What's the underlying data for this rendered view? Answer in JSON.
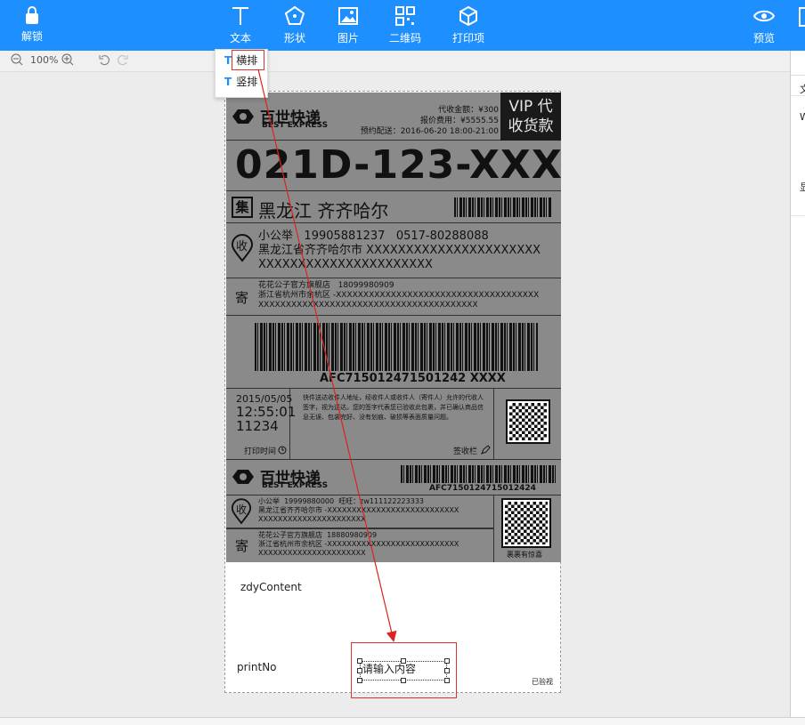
{
  "toolbar": {
    "unlock": "解锁",
    "text": "文本",
    "shape": "形状",
    "image": "图片",
    "qrcode": "二维码",
    "print_item": "打印项",
    "preview": "预览"
  },
  "zoom": {
    "level": "100%"
  },
  "dropdown": {
    "horizontal": "横排",
    "vertical": "竖排"
  },
  "right_panel": {
    "l1": "文",
    "l2": "W",
    "l3": "显"
  },
  "label": {
    "brand_cn": "百世快递",
    "brand_en": "BEST EXPRESS",
    "cod_amount": "代收金额：¥300",
    "insured_fee": "报价费用：¥5555.55",
    "scheduled": "预约配送：2016-06-20 18:00-21:00",
    "vip_line1": "VIP 代",
    "vip_line2": "收货款",
    "big_code": "021D-123-XXX",
    "collect_tag": "集",
    "destination": "黑龙江 齐齐哈尔",
    "recv_tag": "收",
    "recv_name": "小公举",
    "recv_phone1": "19905881237",
    "recv_phone2": "0517-80288088",
    "recv_addr1": "黑龙江省齐齐哈尔市 XXXXXXXXXXXXXXXXXXXXXX",
    "recv_addr2": "XXXXXXXXXXXXXXXXXXXXXX",
    "send_tag": "寄",
    "send_name": "花花公子官方旗舰店",
    "send_phone": "18099980909",
    "send_addr1": "浙江省杭州市余杭区 -XXXXXXXXXXXXXXXXXXXXXXXXXXXXXXXXXXXXX",
    "send_addr2": "XXXXXXXXXXXXXXXXXXXXXXXXXXXXXXXXXXXXXXXX",
    "tracking": "AFC715012471501242 XXXX",
    "date": "2015/05/05",
    "time": "12:55:01",
    "num": "11234",
    "print_time": "打印时间",
    "notice": "快件送达收件人地址，经收件人或收件人（寄件人）允许的代收人签字，视为送达。您的签字代表您已验收此包裹，并已确认商品信息无误、包装完好、没有划痕、破损等表面质量问题。",
    "sign_here": "签收栏",
    "tracking2": "AFC7150124715012424",
    "s2_recv_name": "小公举",
    "s2_recv_phone": "19999880000",
    "s2_wang": "旺旺：zw111122223333",
    "s2_recv_addr1": "黑龙江省齐齐哈尔市 -XXXXXXXXXXXXXXXXXXXXXXXXXXX",
    "s2_recv_addr2": "XXXXXXXXXXXXXXXXXXXXXX",
    "s2_send_name": "花花公子官方旗舰店",
    "s2_send_phone": "18880980909",
    "s2_send_addr1": "浙江省杭州市余杭区 -XXXXXXXXXXXXXXXXXXXXXXXXXXX",
    "s2_send_addr2": "XXXXXXXXXXXXXXXXXXXXXX",
    "surprise": "裹裹有惊喜"
  },
  "canvas": {
    "zdy": "zdyContent",
    "print_no": "printNo",
    "new_text": "请输入内容",
    "verified": "已验视"
  }
}
